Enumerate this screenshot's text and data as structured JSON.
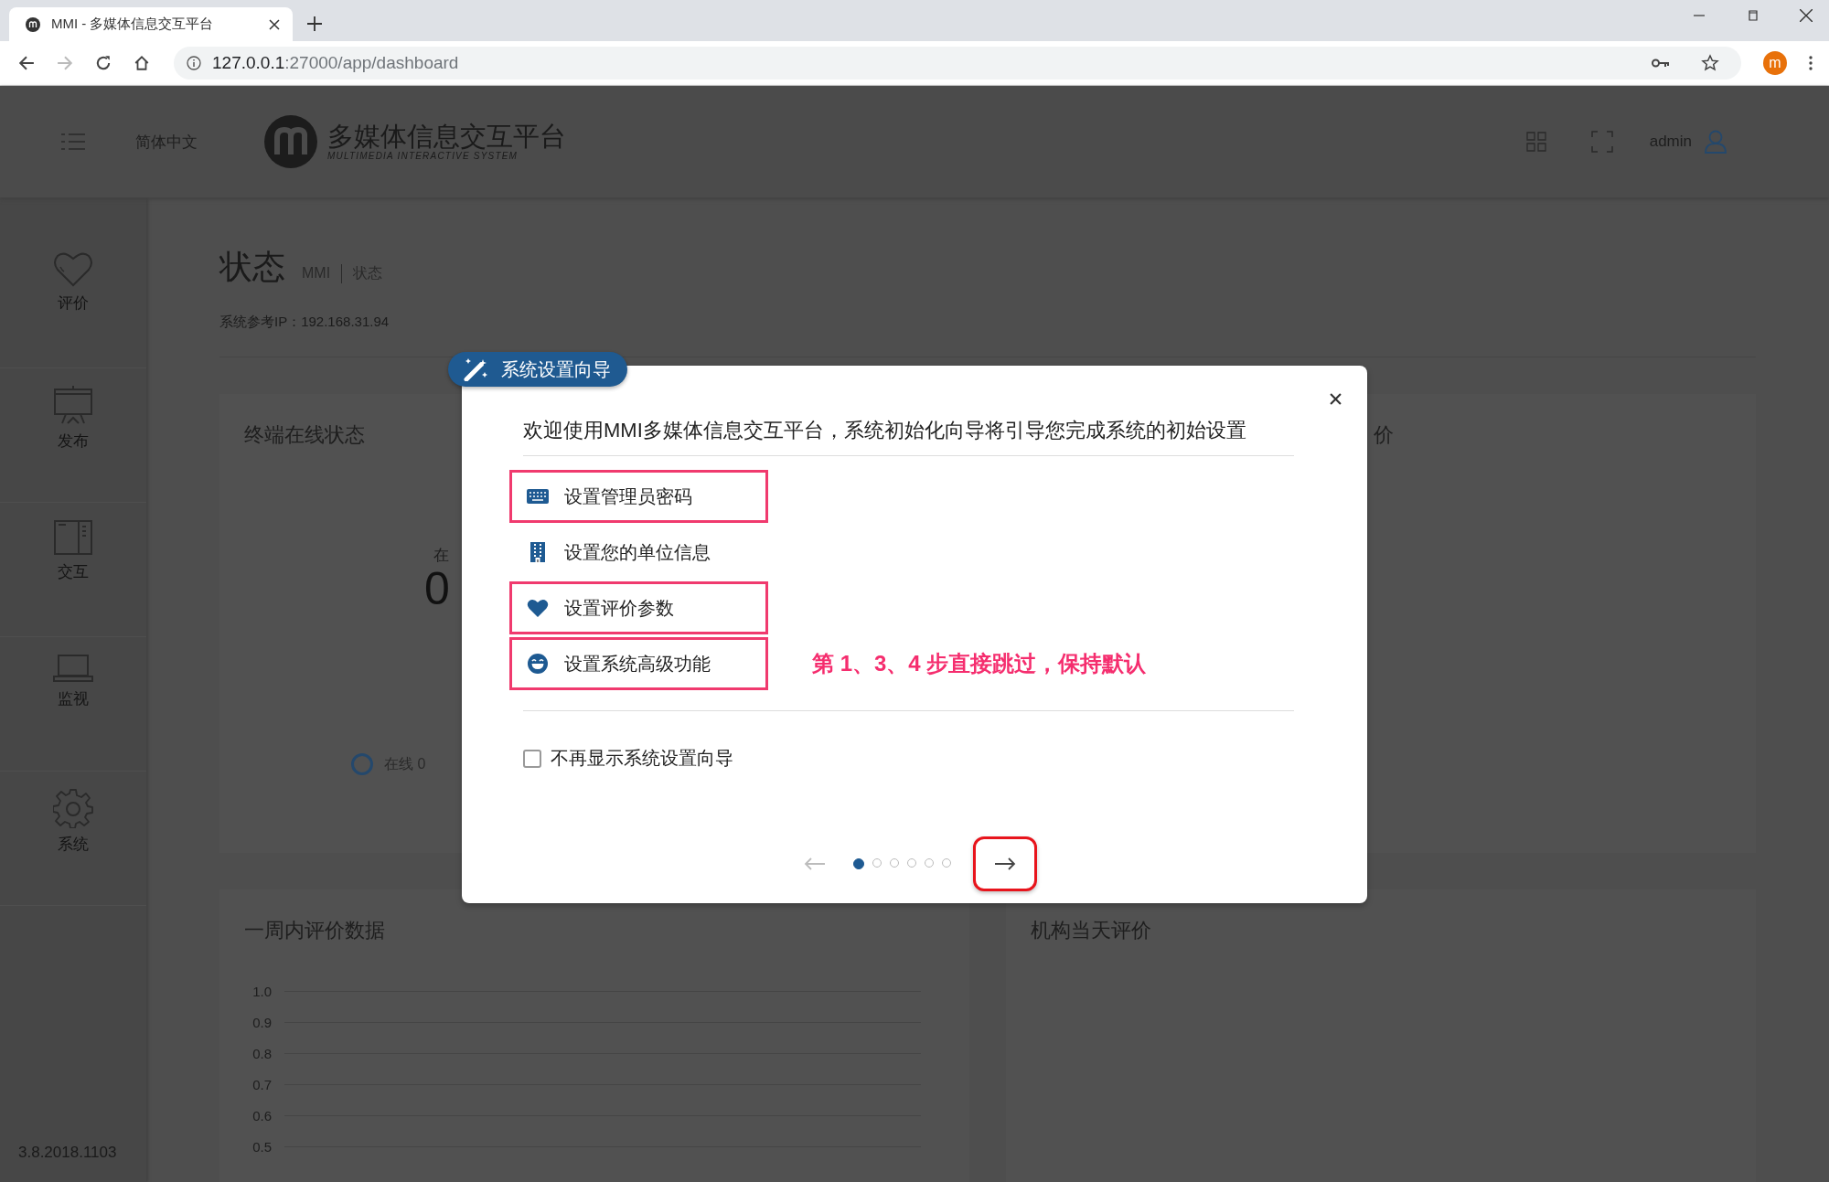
{
  "browser": {
    "tab_title": "MMI - 多媒体信息交互平台",
    "address_host": "127.0.0.1",
    "address_path": ":27000/app/dashboard",
    "forward_disabled": true,
    "profile_initial": "m"
  },
  "header": {
    "language": "简体中文",
    "logo_title": "多媒体信息交互平台",
    "logo_subtitle": "MULTIMEDIA INTERACTIVE SYSTEM",
    "user": "admin"
  },
  "sidebar": {
    "items": [
      {
        "label": "评价",
        "kind": "heart"
      },
      {
        "label": "发布",
        "kind": "easel"
      },
      {
        "label": "交互",
        "kind": "panel"
      },
      {
        "label": "监视",
        "kind": "laptop"
      },
      {
        "label": "系统",
        "kind": "gear"
      }
    ],
    "version": "3.8.2018.1103"
  },
  "page": {
    "title": "状态",
    "breadcrumb": [
      "MMI",
      "状态"
    ],
    "ip": "系统参考IP：192.168.31.94"
  },
  "status_card": {
    "title": "终端在线状态",
    "stat_label": "在",
    "stat_value": "0",
    "legend": [
      {
        "label": "在线 0",
        "color": "#24486c"
      }
    ]
  },
  "side_card": {
    "title": "价"
  },
  "rating_chart_card": {
    "title": "一周内评价数据",
    "axis_labels": [
      "1.0",
      "0.9",
      "0.8",
      "0.7",
      "0.6",
      "0.5"
    ]
  },
  "org_card": {
    "title": "机构当天评价"
  },
  "wizard": {
    "badge": "系统设置向导",
    "intro": "欢迎使用MMI多媒体信息交互平台，系统初始化向导将引导您完成系统的初始设置",
    "steps": [
      {
        "label": "设置管理员密码",
        "kind": "keyboard",
        "highlighted": true
      },
      {
        "label": "设置您的单位信息",
        "kind": "building",
        "highlighted": false
      },
      {
        "label": "设置评价参数",
        "kind": "heart",
        "highlighted": true
      },
      {
        "label": "设置系统高级功能",
        "kind": "smile",
        "highlighted": true
      }
    ],
    "annotation": "第 1、3、4 步直接跳过，保持默认",
    "dont_show_again": {
      "label": "不再显示系统设置向导",
      "checked": false
    },
    "prev_disabled": true,
    "next_highlighted": true,
    "pages": [
      {
        "selected": true
      },
      {
        "selected": false
      },
      {
        "selected": false
      },
      {
        "selected": false
      },
      {
        "selected": false
      },
      {
        "selected": false
      }
    ]
  }
}
